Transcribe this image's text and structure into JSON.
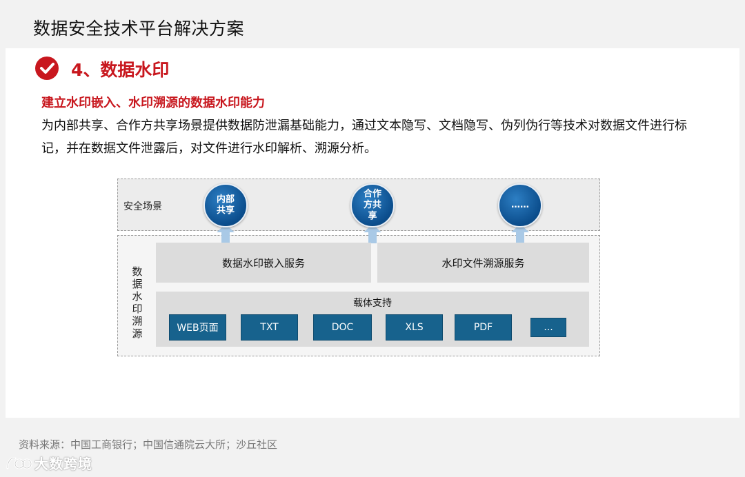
{
  "page": {
    "title": "数据安全技术平台解决方案"
  },
  "section": {
    "icon": "check-circle-icon",
    "title": "4、数据水印",
    "subhead": "建立水印嵌入、水印溯源的数据水印能力",
    "description": "为内部共享、合作方共享场景提供数据防泄漏基础能力，通过文本隐写、文档隐写、伪列伪行等技术对数据文件进行标记，并在数据文件泄露后，对文件进行水印解析、溯源分析。"
  },
  "diagram": {
    "scene_label": "安全场景",
    "vertical_label": "数\n据\n水\n印\n溯\n源",
    "scenes": [
      "内部\n共享",
      "合作\n方共\n享",
      "……"
    ],
    "services": [
      "数据水印嵌入服务",
      "水印文件溯源服务"
    ],
    "carrier_title": "载体支持",
    "carriers": [
      "WEB页面",
      "TXT",
      "DOC",
      "XLS",
      "PDF",
      "..."
    ]
  },
  "footer": {
    "source": "资料来源：中国工商银行；中国信通院云大所；沙丘社区",
    "logo_text": "大数跨境",
    "logo_icon": "big-data-logo-icon"
  },
  "colors": {
    "accent_red": "#c8171e",
    "chip_blue": "#17628d",
    "circle_blue": "#0b4d8c",
    "arrow_blue": "#a9c9e6"
  }
}
